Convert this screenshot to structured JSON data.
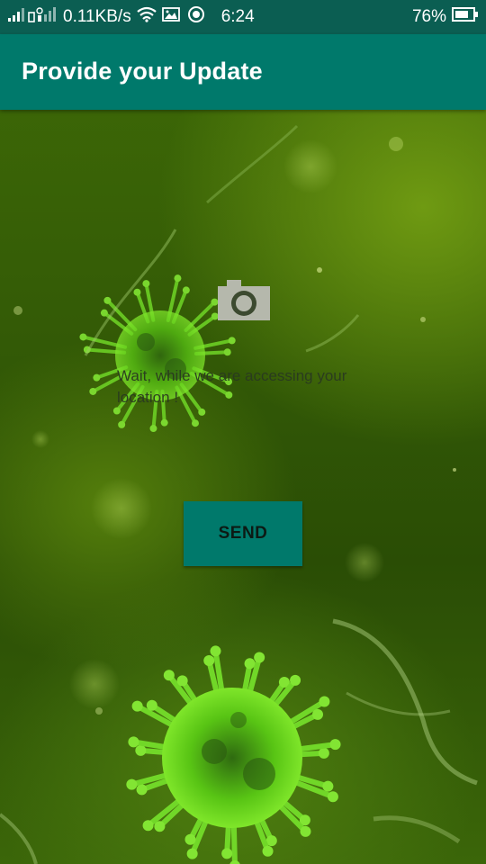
{
  "status_bar": {
    "network_speed": "0.11KB/s",
    "time": "6:24",
    "battery_percent": "76%",
    "icons": [
      "signal-icon",
      "sim-signal-icon",
      "wifi-icon",
      "image-notification-icon",
      "location-notification-icon",
      "battery-icon"
    ]
  },
  "app_bar": {
    "title": "Provide your Update"
  },
  "content": {
    "camera_icon": "camera-icon",
    "location_message": "Wait, while we are accessing your location !",
    "send_label": "SEND"
  },
  "colors": {
    "status_bar": "#0b5e52",
    "app_bar": "#00796b",
    "button": "#00796b",
    "background": "#3a6407"
  }
}
